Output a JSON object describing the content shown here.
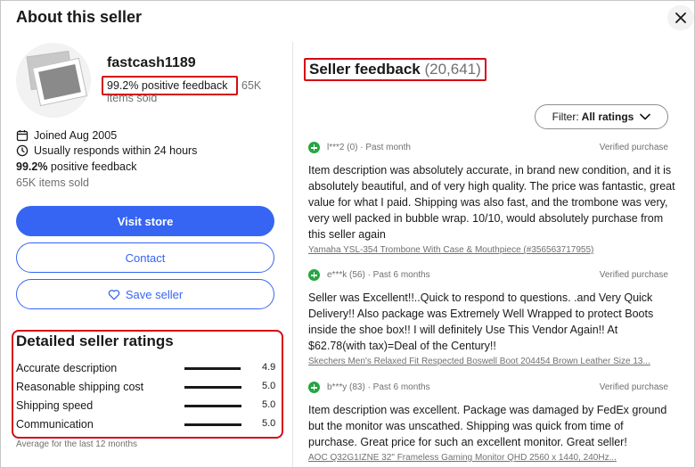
{
  "modal": {
    "title": "About this seller"
  },
  "seller": {
    "username": "fastcash1189",
    "feedback_percent": "99.2% positive feedback",
    "items_sold_a": "65K",
    "items_sold_b": "items sold",
    "joined": "Joined Aug 2005",
    "response": "Usually responds within 24 hours",
    "feedback_strong": "99.2%",
    "feedback_rest": " positive feedback",
    "items_sold_full": "65K items sold"
  },
  "buttons": {
    "visit_store": "Visit store",
    "contact": "Contact",
    "save_seller": "Save seller"
  },
  "detailed_ratings": {
    "title": "Detailed seller ratings",
    "rows": [
      {
        "label": "Accurate description",
        "value": "4.9"
      },
      {
        "label": "Reasonable shipping cost",
        "value": "5.0"
      },
      {
        "label": "Shipping speed",
        "value": "5.0"
      },
      {
        "label": "Communication",
        "value": "5.0"
      }
    ],
    "fill_fraction": [
      0.98,
      1.0,
      1.0,
      1.0
    ],
    "note": "Average for the last 12 months"
  },
  "feedback": {
    "title": "Seller feedback",
    "count": "(20,641)",
    "filter_label": "Filter:",
    "filter_value": "All ratings",
    "reviews": [
      {
        "user": "l***2 (0) · Past month",
        "verified": "Verified purchase",
        "text": "Item description was absolutely accurate, in brand new condition, and it is absolutely beautiful, and of very high quality. The price was fantastic, great value for what I paid. Shipping was also fast, and the trombone was very, very well packed in bubble wrap. 10/10, would absolutely purchase from this seller again",
        "item": "Yamaha YSL-354 Trombone With Case & Mouthpiece (#356563717955)"
      },
      {
        "user": "e***k (56) · Past 6 months",
        "verified": "Verified purchase",
        "text": "Seller was Excellent!!..Quick to respond to questions. .and Very Quick Delivery!! Also package was Extremely Well Wrapped to protect Boots inside the shoe box!! I will definitely Use This Vendor Again!! At $62.78(with tax)=Deal of the Century!!",
        "item": "Skechers Men's Relaxed Fit Respected Boswell Boot 204454 Brown Leather Size 13..."
      },
      {
        "user": "b***y (83) · Past 6 months",
        "verified": "Verified purchase",
        "text": "Item description was excellent. Package was damaged by FedEx ground but the monitor was unscathed. Shipping was quick from time of purchase. Great price for such an excellent monitor. Great seller!",
        "item": "AOC Q32G1IZNE 32\" Frameless Gaming Monitor QHD 2560 x 1440, 240Hz..."
      }
    ]
  },
  "colors": {
    "accent": "#3665f3",
    "highlight": "#d40b16",
    "positive": "#26a541"
  }
}
